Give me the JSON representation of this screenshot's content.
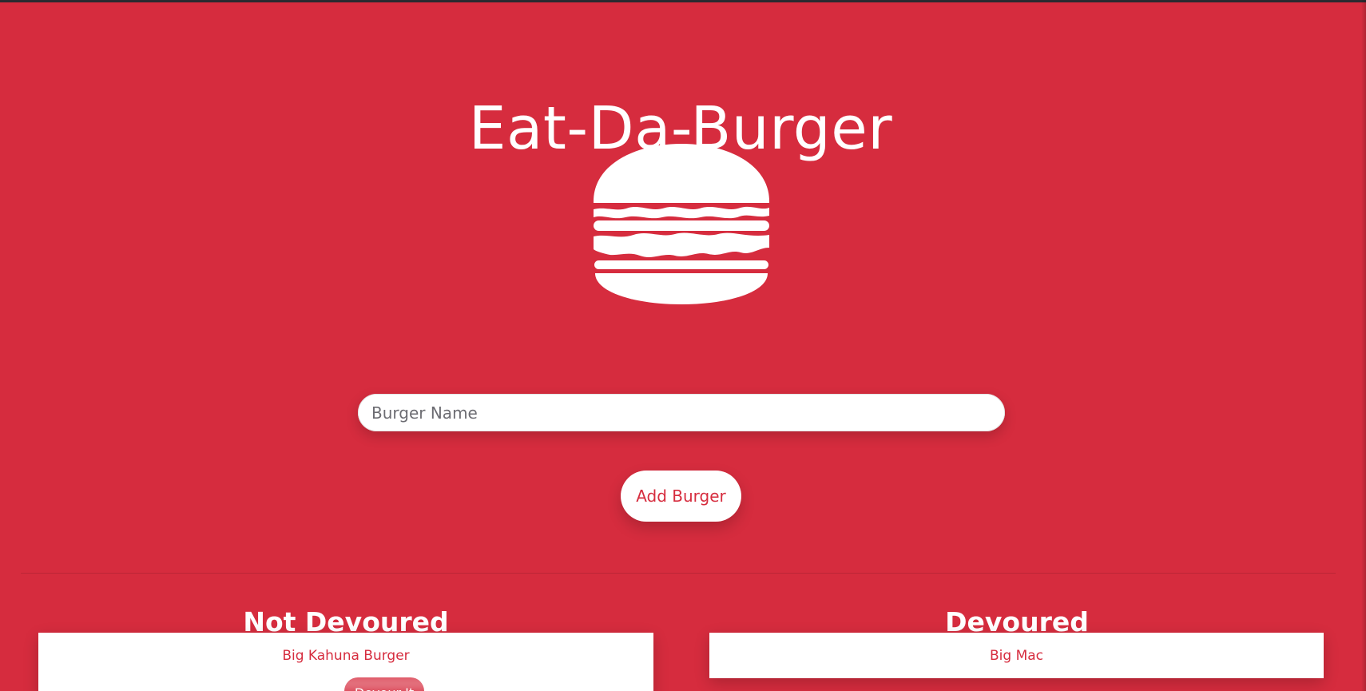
{
  "app": {
    "title": "Eat-Da-Burger"
  },
  "form": {
    "burger_name_placeholder": "Burger Name",
    "add_button_label": "Add Burger"
  },
  "columns": {
    "not_devoured": {
      "heading": "Not Devoured",
      "items": [
        {
          "name": "Big Kahuna Burger",
          "button_label": "Devour It"
        }
      ]
    },
    "devoured": {
      "heading": "Devoured",
      "items": [
        {
          "name": "Big Mac"
        }
      ]
    }
  },
  "icons": {
    "hero": "burger-icon"
  },
  "colors": {
    "background": "#d62c3e",
    "accent": "#d62c3e",
    "surface": "#ffffff",
    "text_light": "#ffffff"
  }
}
